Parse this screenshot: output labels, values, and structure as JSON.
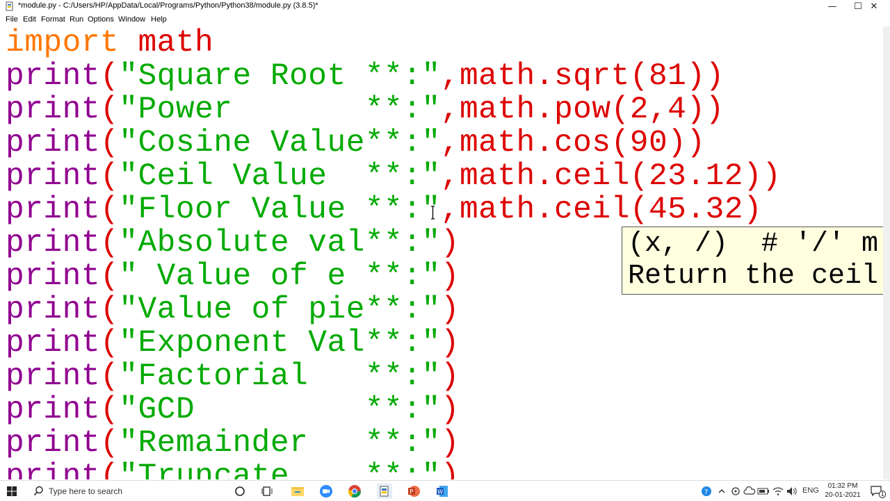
{
  "window": {
    "title": "*module.py - C:/Users/HP/AppData/Local/Programs/Python/Python38/module.py (3.8.5)*",
    "minimize": "—",
    "maximize": "☐",
    "close": "✕"
  },
  "menu": [
    "File",
    "Edit",
    "Format",
    "Run",
    "Options",
    "Window",
    "Help"
  ],
  "code": {
    "l1": {
      "kw": "import",
      "rest": " math"
    },
    "l2": {
      "fn": "print",
      "o": "(",
      "s": "\"Square Root **:\"",
      "r": ",math.sqrt(81))"
    },
    "l3": {
      "fn": "print",
      "o": "(",
      "s": "\"Power       **:\"",
      "r": ",math.pow(2,4))"
    },
    "l4": {
      "fn": "print",
      "o": "(",
      "s": "\"Cosine Value**:\"",
      "r": ",math.cos(90))"
    },
    "l5": {
      "fn": "print",
      "o": "(",
      "s": "\"Ceil Value  **:\"",
      "r": ",math.ceil(23.12))"
    },
    "l6": {
      "fn": "print",
      "o": "(",
      "s": "\"Floor Value **:\"",
      "r": ",math.ceil(45.32)"
    },
    "l7": {
      "fn": "print",
      "o": "(",
      "s": "\"Absolute val**:\"",
      "r": ")"
    },
    "l8": {
      "fn": "print",
      "o": "(",
      "s": "\" Value of e **:\"",
      "r": ")"
    },
    "l9": {
      "fn": "print",
      "o": "(",
      "s": "\"Value of pie**:\"",
      "r": ")"
    },
    "l10": {
      "fn": "print",
      "o": "(",
      "s": "\"Exponent Val**:\"",
      "r": ")"
    },
    "l11": {
      "fn": "print",
      "o": "(",
      "s": "\"Factorial   **:\"",
      "r": ")"
    },
    "l12": {
      "fn": "print",
      "o": "(",
      "s": "\"GCD         **:\"",
      "r": ")"
    },
    "l13": {
      "fn": "print",
      "o": "(",
      "s": "\"Remainder   **:\"",
      "r": ")"
    },
    "l14": {
      "fn": "print",
      "o": "(",
      "s": "\"Truncate    **:\"",
      "r": ")"
    }
  },
  "calltip": {
    "line1": "(x, /)  # '/' m",
    "line2": "Return the ceil"
  },
  "taskbar": {
    "search_placeholder": "Type here to search",
    "language": "ENG",
    "time": "01:32 PM",
    "date": "20-01-2021",
    "notification_count": "1"
  },
  "colors": {
    "keyword": "#ff7700",
    "builtin": "#900090",
    "string": "#00aa00",
    "default": "#dd0000",
    "calltip_bg": "#ffffe0"
  }
}
